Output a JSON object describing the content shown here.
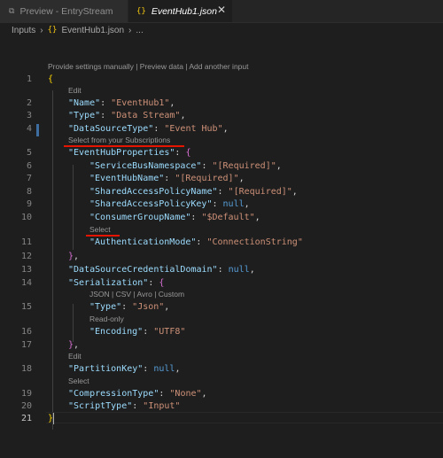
{
  "tabs": [
    {
      "label": "Preview - EntryStream",
      "icon": "preview-icon",
      "glyph": "⧉",
      "active": false
    },
    {
      "label": "EventHub1.json",
      "icon": "json-braces-icon",
      "glyph": "{}",
      "active": true,
      "close": "✕"
    }
  ],
  "breadcrumb": {
    "root": "Inputs",
    "sep": "›",
    "file": "EventHub1.json",
    "file_icon": "{}",
    "more": "..."
  },
  "lens": {
    "top": "Provide settings manually | Preview data | Add another input",
    "edit": "Edit",
    "subscriptions": "Select from your Subscriptions",
    "select": "Select",
    "formats": "JSON | CSV | Avro | Custom",
    "readonly": "Read-only"
  },
  "lines": {
    "l1": "{",
    "l2k": "\"Name\"",
    "l2v": "\"EventHub1\"",
    "l3k": "\"Type\"",
    "l3v": "\"Data Stream\"",
    "l4k": "\"DataSourceType\"",
    "l4v": "\"Event Hub\"",
    "l5k": "\"EventHubProperties\"",
    "l5b": "{",
    "l6k": "\"ServiceBusNamespace\"",
    "l6v": "\"[Required]\"",
    "l7k": "\"EventHubName\"",
    "l7v": "\"[Required]\"",
    "l8k": "\"SharedAccessPolicyName\"",
    "l8v": "\"[Required]\"",
    "l9k": "\"SharedAccessPolicyKey\"",
    "l9v": "null",
    "l10k": "\"ConsumerGroupName\"",
    "l10v": "\"$Default\"",
    "l11k": "\"AuthenticationMode\"",
    "l11v": "\"ConnectionString\"",
    "l12": "}",
    "l13k": "\"DataSourceCredentialDomain\"",
    "l13v": "null",
    "l14k": "\"Serialization\"",
    "l14b": "{",
    "l15k": "\"Type\"",
    "l15v": "\"Json\"",
    "l16k": "\"Encoding\"",
    "l16v": "\"UTF8\"",
    "l17": "}",
    "l18k": "\"PartitionKey\"",
    "l18v": "null",
    "l19k": "\"CompressionType\"",
    "l19v": "\"None\"",
    "l20k": "\"ScriptType\"",
    "l20v": "\"Input\"",
    "l21": "}"
  },
  "line_numbers": [
    "1",
    "2",
    "3",
    "4",
    "5",
    "6",
    "7",
    "8",
    "9",
    "10",
    "11",
    "12",
    "13",
    "14",
    "15",
    "16",
    "17",
    "18",
    "19",
    "20",
    "21"
  ],
  "colors": {
    "key": "#9cdcfe",
    "string": "#ce9178",
    "keyword": "#569cd6",
    "annotation_underline": "#e51400"
  }
}
